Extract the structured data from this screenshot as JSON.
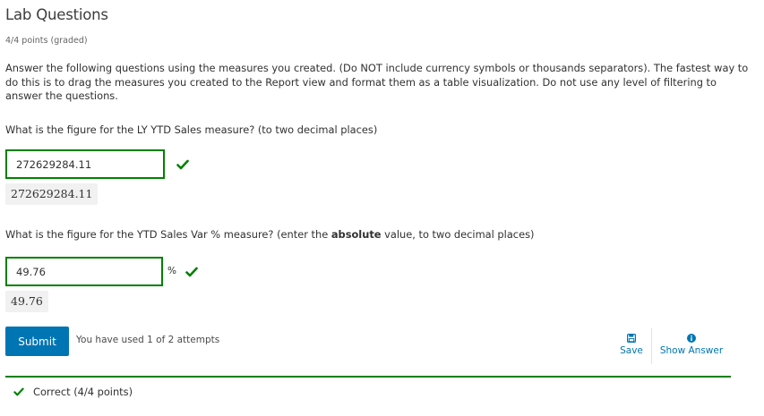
{
  "problem": {
    "title": "Lab Questions",
    "points": "4/4 points (graded)",
    "intro": "Answer the following questions using the measures you created. (Do NOT include currency symbols or thousands separators). The fastest way to do this is to drag the measures you created to the Report view and format them as a table visualization. Do not use any level of filtering to answer the questions."
  },
  "questions": [
    {
      "label": "What is the figure for the LY YTD Sales measure? (to two decimal places)",
      "value": "272629284.11",
      "preview": "272629284.11",
      "status": "correct"
    },
    {
      "label_before": "What is the figure for the YTD Sales Var % measure? (enter the ",
      "label_bold": "absolute",
      "label_after": " value, to two decimal places)",
      "value": "49.76",
      "unit": "%",
      "preview": "49.76",
      "status": "correct"
    }
  ],
  "actions": {
    "submit_label": "Submit",
    "attempts_text": "You have used 1 of 2 attempts",
    "save_label": "Save",
    "show_answer_label": "Show Answer"
  },
  "status": {
    "text": "Correct (4/4 points)"
  },
  "colors": {
    "correct": "#008100",
    "primary": "#0075b4"
  },
  "icons": {
    "check": "check-icon",
    "save": "floppy-disk-icon",
    "info": "info-circle-icon"
  }
}
